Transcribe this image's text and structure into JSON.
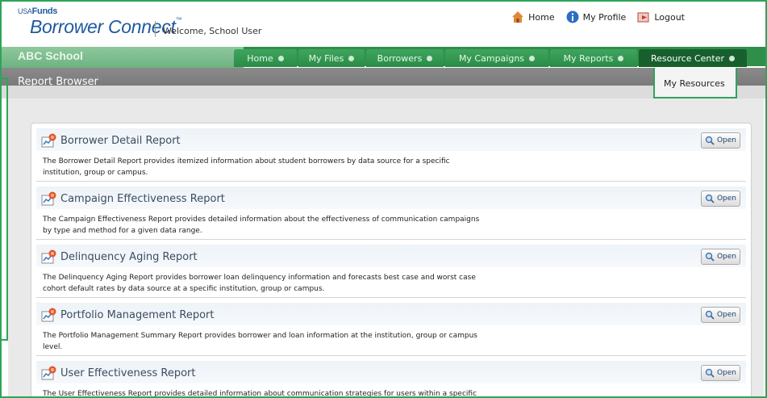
{
  "header": {
    "logo_small_prefix": "USA",
    "logo_small_brand": "Funds",
    "logo_title": "Borrower Connect",
    "logo_tm": "™",
    "welcome": "Welcome, School User",
    "links": [
      {
        "label": "Home",
        "icon": "home-icon"
      },
      {
        "label": "My Profile",
        "icon": "info-icon"
      },
      {
        "label": "Logout",
        "icon": "logout-icon"
      }
    ]
  },
  "nav": {
    "school_name": "ABC School",
    "tabs": [
      {
        "label": "Home"
      },
      {
        "label": "My Files"
      },
      {
        "label": "Borrowers"
      },
      {
        "label": "My Campaigns"
      },
      {
        "label": "My Reports"
      },
      {
        "label": "Resource Center",
        "active": true
      }
    ],
    "dropdown_item": "My Resources"
  },
  "page": {
    "title": "Report Browser"
  },
  "reports": [
    {
      "title": "Borrower Detail Report",
      "description": "The Borrower Detail Report provides itemized information about student borrowers by data source for a specific institution, group or campus.",
      "open_label": "Open"
    },
    {
      "title": "Campaign Effectiveness Report",
      "description": "The Campaign Effectiveness Report provides detailed information about the effectiveness of communication campaigns by type and method for a given data range.",
      "open_label": "Open"
    },
    {
      "title": "Delinquency Aging Report",
      "description": "The Delinquency Aging Report provides borrower loan delinquency information and forecasts best case and worst case cohort default rates by data source at a specific institution, group or campus.",
      "open_label": "Open"
    },
    {
      "title": "Portfolio Management Report",
      "description": "The Portfolio Management Summary Report provides borrower and loan information at the institution, group or campus level.",
      "open_label": "Open"
    },
    {
      "title": "User Effectiveness Report",
      "description": "The User Effectiveness Report provides detailed information about communication strategies for users within a specific institution.",
      "open_label": "Open"
    }
  ],
  "colors": {
    "accent_green": "#2ea45a",
    "tab_green": "#2a8c46",
    "active_tab": "#17602d",
    "brand_blue": "#1f5a9c"
  }
}
